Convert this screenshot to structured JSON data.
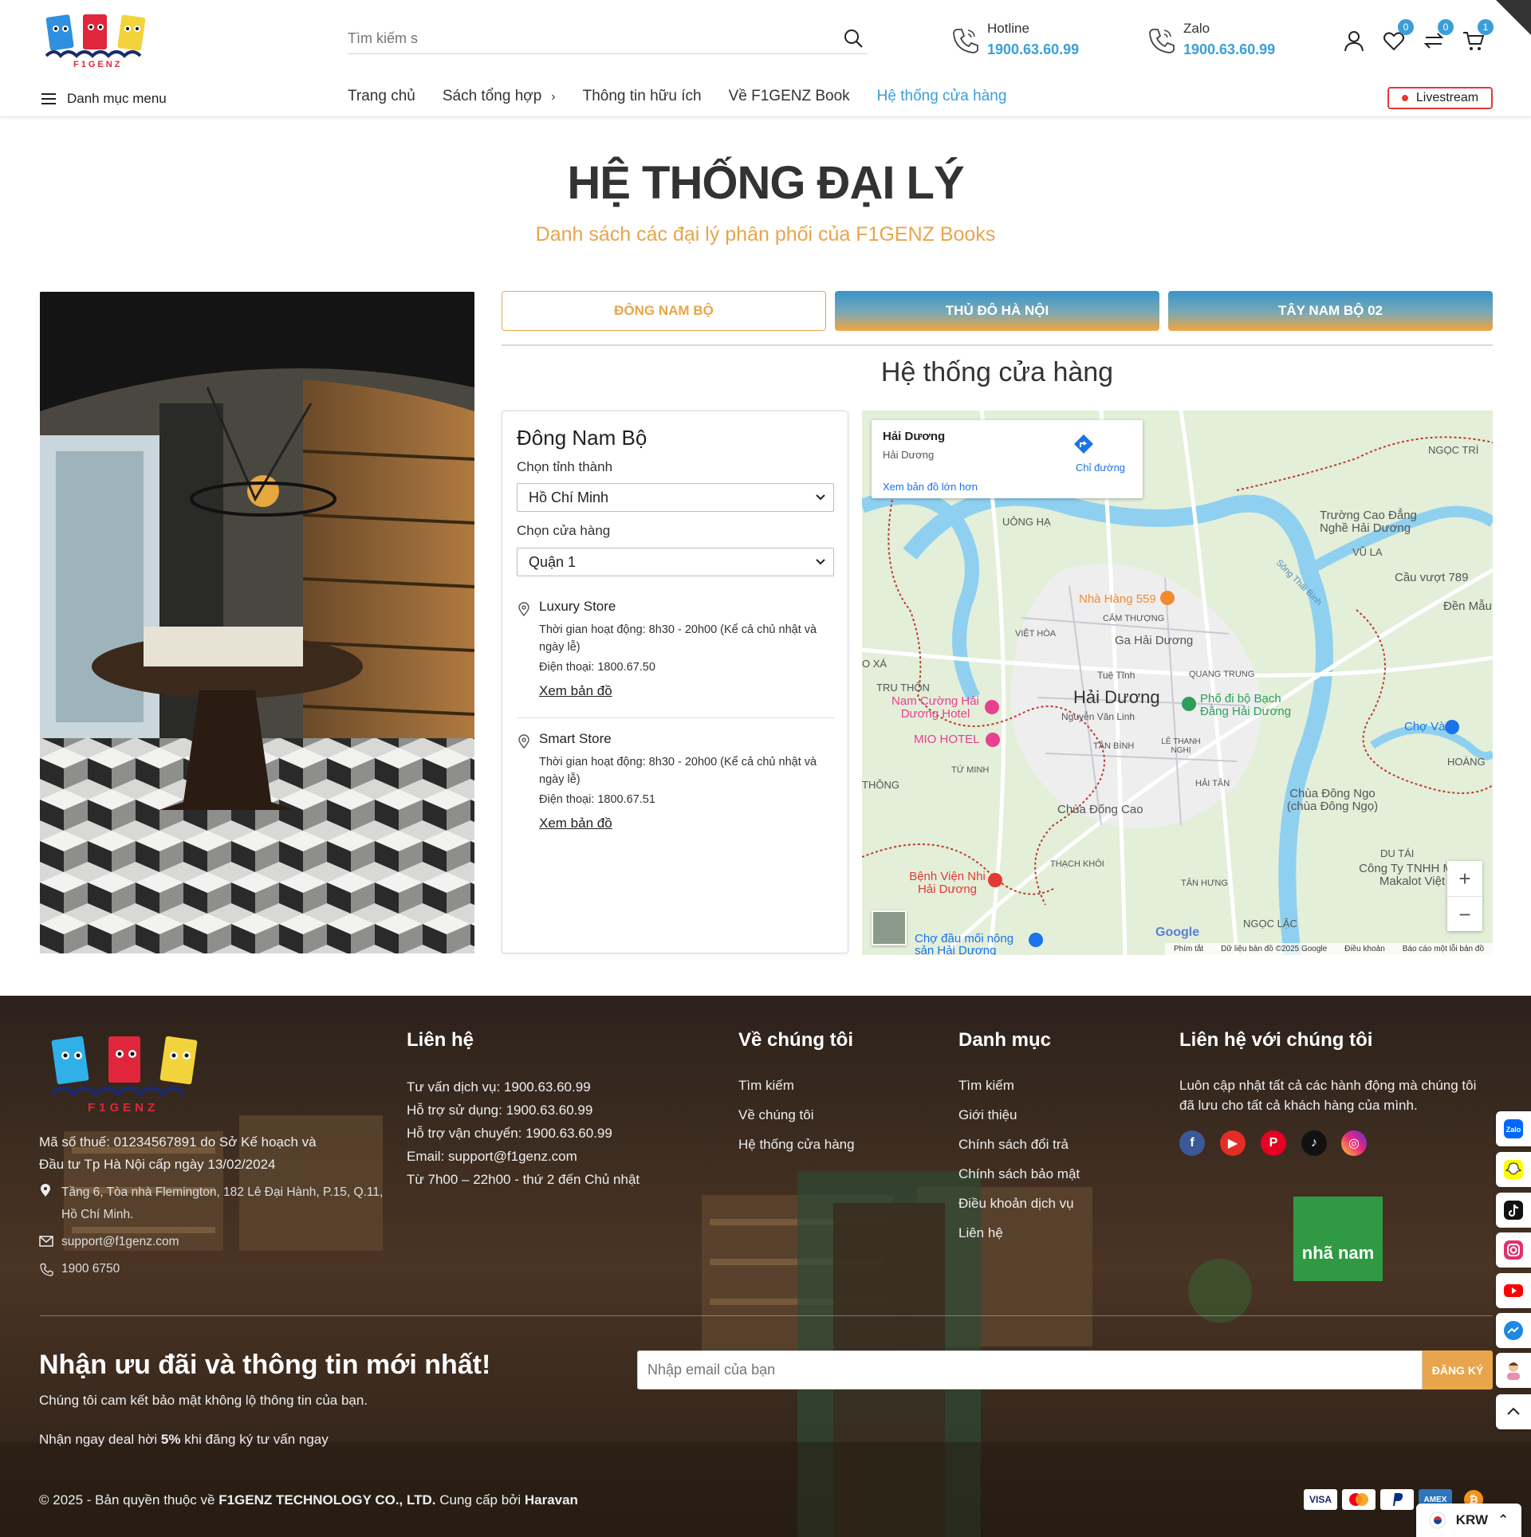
{
  "header": {
    "search_placeholder": "Tìm kiếm s",
    "hotline": {
      "label": "Hotline",
      "number": "1900.63.60.99"
    },
    "zalo": {
      "label": "Zalo",
      "number": "1900.63.60.99"
    },
    "wishlist_count": "0",
    "compare_count": "0",
    "cart_count": "1",
    "menu_label": "Danh mục menu",
    "nav": [
      {
        "label": "Trang chủ"
      },
      {
        "label": "Sách tổng hợp"
      },
      {
        "label": "Thông tin hữu ích"
      },
      {
        "label": "Về F1GENZ Book"
      },
      {
        "label": "Hệ thống cửa hàng"
      }
    ],
    "livestream": "Livestream",
    "logo_text": "F1GENZ"
  },
  "hero": {
    "title": "HỆ THỐNG ĐẠI LÝ",
    "subtitle": "Danh sách các đại lý phân phối của F1GENZ Books"
  },
  "tabs": [
    "ĐÔNG NAM BỘ",
    "THỦ ĐÔ HÀ NỘI",
    "TÂY NAM BỘ 02"
  ],
  "section_title": "Hệ thống cửa hàng",
  "panel": {
    "region": "Đông Nam Bộ",
    "province_label": "Chọn tỉnh thành",
    "province_value": "Hồ Chí Minh",
    "store_label": "Chọn cửa hàng",
    "store_value": "Quận 1",
    "stores": [
      {
        "name": "Luxury Store",
        "hours": "Thời gian hoạt động: 8h30 - 20h00 (Kể cả chủ nhật và ngày lễ)",
        "phone": "Điện thoại: 1800.67.50",
        "map_link": "Xem bản đồ"
      },
      {
        "name": "Smart Store",
        "hours": "Thời gian hoạt động: 8h30 - 20h00 (Kể cả chủ nhật và ngày lễ)",
        "phone": "Điện thoại: 1800.67.51",
        "map_link": "Xem bản đồ"
      }
    ]
  },
  "map": {
    "card_title": "Hải Dương",
    "card_sub": "Hải Dương",
    "card_link": "Xem bản đồ lớn hơn",
    "directions": "Chỉ đường",
    "labels": {
      "city": "Hải Dương",
      "ngoc_tri": "NGỌC TRÌ",
      "uong_ha": "UÔNG HẠ",
      "truong": "Trường Cao Đẳng Nghề Hải Dương",
      "vu_la": "VŨ LA",
      "cau_vuot": "Cầu vượt 789",
      "den_mau": "Đền Mẫu",
      "nha_hang": "Nhà Hàng 559",
      "cam_thuong": "CẨM THƯỢNG",
      "viet_hoa": "VIỆT HÒA",
      "ga": "Ga Hải Dương",
      "tue_tinh": "Tuệ Tĩnh",
      "quang_trung": "QUANG TRUNG",
      "o_xa": "O XÁ",
      "tru_thon": "TRU THÔN",
      "nam_cuong": "Nam Cường Hải Dương Hotel",
      "nguyen_van_linh": "Nguyễn Văn Linh",
      "pho_di_bo": "Phố đi bộ Bạch Đằng Hải Dương",
      "mio": "MIO HOTEL",
      "tan_binh": "TÂN BÌNH",
      "le_thanh_nghi": "LÊ THANH NGHỊ",
      "cho_vang": "Chợ Vàng",
      "hoang": "HOÀNG",
      "tu_minh": "TỨ MINH",
      "thong": "THÔNG",
      "hai_tan": "HẢI TÂN",
      "chua_dong_cao": "Chùa Đống Cao",
      "chua_dong_ngo": "Chùa Đông Ngo (chùa Đông Ngọ)",
      "du_tai": "DU TÁI",
      "thach_khoi": "THẠCH KHÔI",
      "cong_ty": "Công Ty TNHH Mặc Makalot Việt",
      "benh_vien": "Bệnh Viện Nhi Hải Dương",
      "tan_hung": "TÂN HƯNG",
      "ngoc_lac": "NGỌC LẶC",
      "cho_dau_moi": "Chợ đầu mối nông sản Hải Dương",
      "song_thai_binh": "Sông Thái Bình"
    },
    "footer": [
      "Phím tắt",
      "Dữ liệu bản đồ ©2025 Google",
      "Điều khoản",
      "Báo cáo một lỗi bản đồ"
    ],
    "google": "Google"
  },
  "footer": {
    "tax": "Mã số thuế: 01234567891 do Sở Kế hoạch và",
    "tax2": "Đầu tư Tp Hà Nội cấp ngày 13/02/2024",
    "address": "Tầng 6, Tòa nhà Flemington, 182 Lê Đại Hành, P.15, Q.11,",
    "address2": "Hồ Chí Minh.",
    "email": "support@f1genz.com",
    "phone": "1900 6750",
    "contact_title": "Liên hệ",
    "contact_lines": [
      "Tư vấn dịch vụ: 1900.63.60.99",
      "Hỗ trợ sử dụng: 1900.63.60.99",
      "Hỗ trợ vận chuyển: 1900.63.60.99",
      "Email: support@f1genz.com",
      "Từ 7h00 – 22h00 - thứ 2 đến Chủ nhật"
    ],
    "about_title": "Về chúng tôi",
    "about_links": [
      "Tìm kiếm",
      "Về chúng tôi",
      "Hệ thống cửa hàng"
    ],
    "cat_title": "Danh mục",
    "cat_links": [
      "Tìm kiếm",
      "Giới thiệu",
      "Chính sách đổi trả",
      "Chính sách bảo mật",
      "Điều khoản dịch vụ",
      "Liên hệ"
    ],
    "follow_title": "Liên hệ với chúng tôi",
    "follow_text": "Luôn cập nhật tất cả các hành động mà chúng tôi",
    "follow_text2": "đã lưu cho tất cả khách hàng của mình.",
    "newsletter_title": "Nhận ưu đãi và thông tin mới nhất!",
    "newsletter_sub": "Chúng tôi cam kết bảo mật không lộ thông tin của bạn.",
    "deal_pre": "Nhận ngay deal hời ",
    "deal_pct": "5%",
    "deal_post": " khi đăng ký tư vấn ngay",
    "email_placeholder": "Nhập email của bạn",
    "subscribe": "ĐĂNG KÝ",
    "copy_pre": "© 2025 - Bản quyền thuộc về ",
    "copy_company": "F1GENZ TECHNOLOGY CO., LTD.",
    "copy_mid": " Cung cấp bởi ",
    "copy_provider": "Haravan",
    "currency": "KRW",
    "sign_text": "nhã nam",
    "zalo_icon_text": "Zalo",
    "pay_visa": "VISA",
    "pay_amex": "AMEX"
  },
  "colors": {
    "accent": "#3a9fd8",
    "orange": "#e8a54b",
    "live": "#e53935"
  }
}
